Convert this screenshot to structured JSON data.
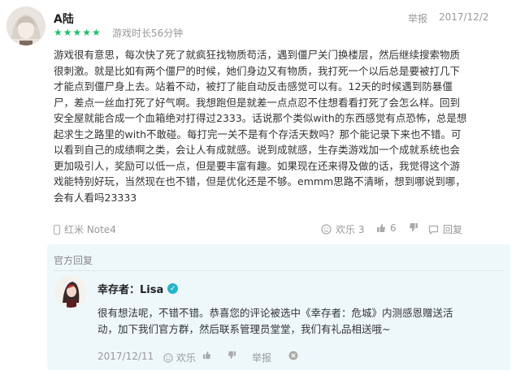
{
  "review": {
    "user_name": "A陆",
    "rating_stars": "★★★★★",
    "rating": 5,
    "playtime": "游戏时长56分钟",
    "report_label": "举报",
    "date": "2017/12/2",
    "text": "游戏很有意思，每次快了死了就疯狂找物质苟活，遇到僵尸关门换楼层，然后继续搜索物质\n很刺激。就是比如有两个僵尸的时候，她们身边又有物质，我打死一个以后总是要被打几下\n才能点到僵尸身上去。站着不动，被打了能自动反击感觉可以有。12天的时候遇到防暴僵\n尸，差点一丝血打死了好气啊。我想跑但是就差一点点忍不住想看看打死了会怎么样。回到\n安全屋就能合成一个血箱绝对打得过2333。话说那个类似with的东西感觉有点恐怖，总是想\n起求生之路里的with不敢碰。每打完一关不是有个存活天数吗？那个能记录下来也不错。可\n以看到自己的成绩啊之类，会让人有成就感。说到成就感，生存类游戏加一个成就系统也会\n更加吸引人，奖励可以低一点，但是要丰富有趣。如果现在还来得及做的话，我觉得这个游\n戏能特别好玩，当然现在也不错，但是优化还是不够。emmm思路不清晰，想到哪说到哪，\n会有人看吗23333",
    "device": "红米 Note4",
    "fun_label": "欢乐 3",
    "like_count": "6",
    "reply_label": "回复"
  },
  "official_reply": {
    "section_title": "官方回复",
    "dev_name": "幸存者：Lisa",
    "text": "很有想法呢，不错不错。恭喜您的评论被选中《幸存者：危城》内测感恩赠送活\n动，加下我们官方群，然后联系管理员堂堂，我们有礼品相送哦~",
    "date": "2017/12/11",
    "fun_label": "欢乐",
    "report_label": "举报"
  },
  "colors": {
    "star_green": "#1fbf6a",
    "official_bg": "#eef8fb",
    "verified_teal": "#27b4c9"
  }
}
